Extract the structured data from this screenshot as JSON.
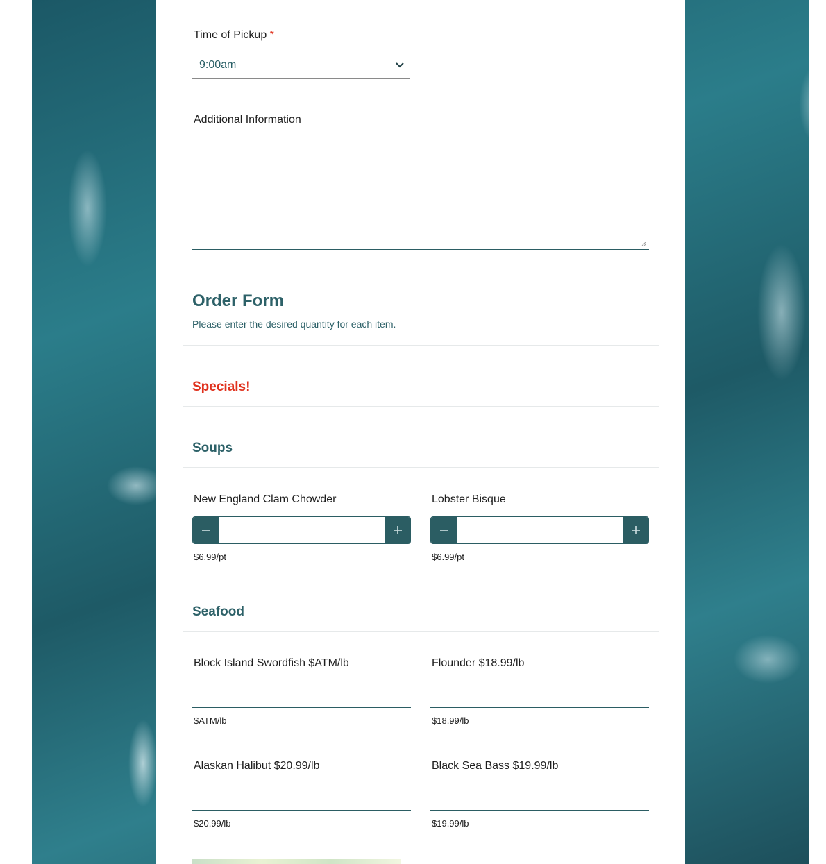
{
  "pickup": {
    "label": "Time of Pickup",
    "required_mark": "*",
    "selected": "9:00am"
  },
  "additional_info": {
    "label": "Additional Information",
    "value": ""
  },
  "order_form": {
    "title": "Order Form",
    "subtitle": "Please enter the desired quantity for each item."
  },
  "sections": {
    "specials": "Specials!",
    "soups": "Soups",
    "seafood": "Seafood"
  },
  "soups": [
    {
      "label": "New England Clam Chowder",
      "quantity": "",
      "price": "$6.99/pt"
    },
    {
      "label": "Lobster Bisque",
      "quantity": "",
      "price": "$6.99/pt"
    }
  ],
  "seafood": [
    {
      "label": "Block Island Swordfish $ATM/lb",
      "value": "",
      "price": "$ATM/lb"
    },
    {
      "label": "Flounder $18.99/lb",
      "value": "",
      "price": "$18.99/lb"
    },
    {
      "label": "Alaskan Halibut $20.99/lb",
      "value": "",
      "price": "$20.99/lb"
    },
    {
      "label": "Black Sea Bass $19.99/lb",
      "value": "",
      "price": "$19.99/lb"
    }
  ],
  "colors": {
    "accent": "#2b5d63",
    "heading": "#2d6168",
    "special": "#e0311d",
    "background_water": "#2b7d8a"
  },
  "icons": {
    "select_chevron": "chevron-down-icon",
    "decrement": "minus-icon",
    "increment": "plus-icon"
  }
}
